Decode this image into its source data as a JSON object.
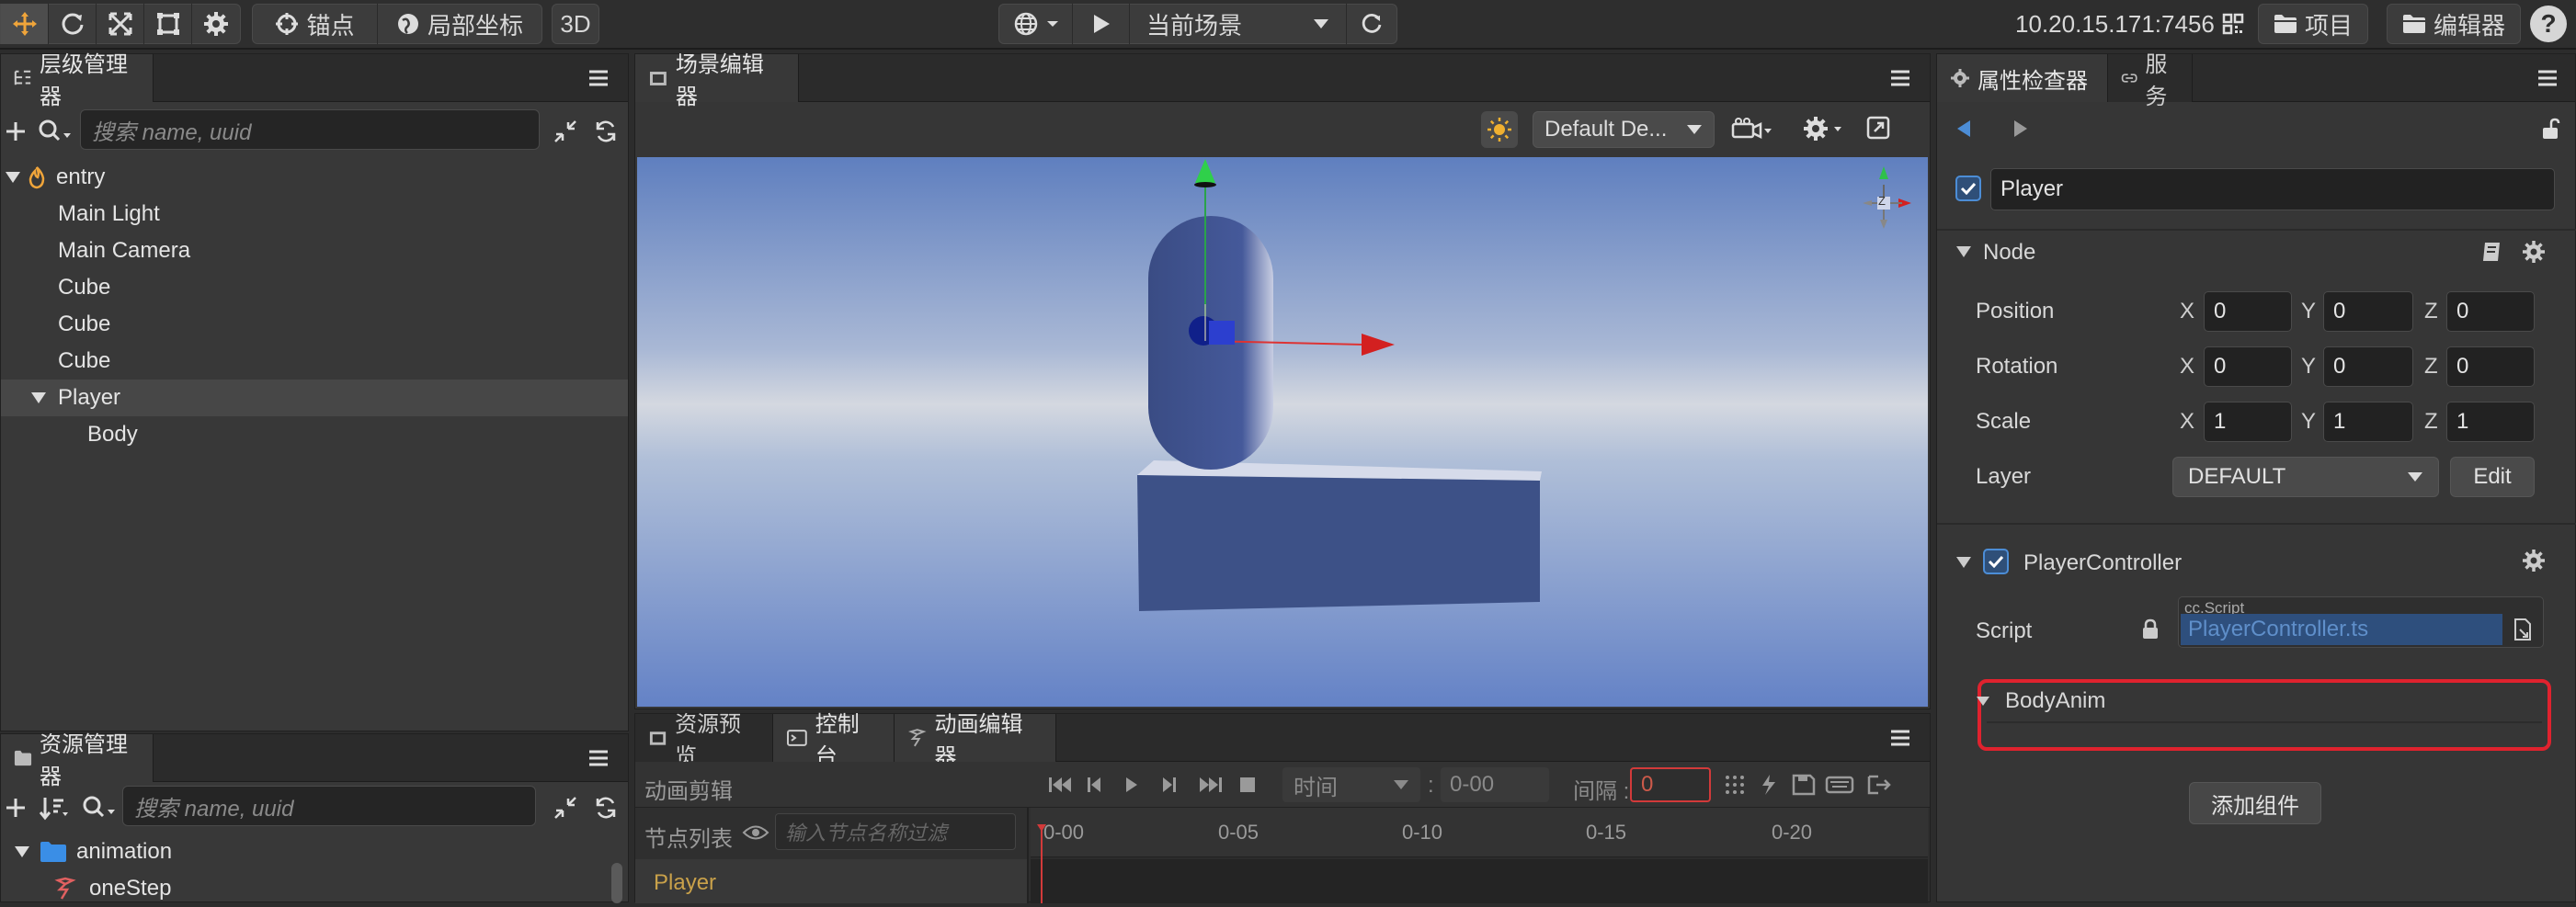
{
  "toolbar": {
    "anchor_label": "锚点",
    "local_coord_label": "局部坐标",
    "mode_3d_label": "3D",
    "scene_select": "当前场景",
    "address": "10.20.15.171:7456",
    "project_label": "项目",
    "editor_label": "编辑器"
  },
  "hierarchy": {
    "title": "层级管理器",
    "search_placeholder": "搜索 name, uuid",
    "items": [
      {
        "label": "entry"
      },
      {
        "label": "Main Light"
      },
      {
        "label": "Main Camera"
      },
      {
        "label": "Cube"
      },
      {
        "label": "Cube"
      },
      {
        "label": "Cube"
      },
      {
        "label": "Player"
      },
      {
        "label": "Body"
      }
    ]
  },
  "assets": {
    "title": "资源管理器",
    "search_placeholder": "搜索 name, uuid",
    "items": [
      {
        "label": "animation"
      },
      {
        "label": "oneStep"
      }
    ]
  },
  "scene": {
    "title": "场景编辑器",
    "camera_select": "Default De...",
    "gizmo_axis_label": "Z"
  },
  "bottom": {
    "tabs": [
      {
        "label": "资源预览"
      },
      {
        "label": "控制台"
      },
      {
        "label": "动画编辑器"
      }
    ],
    "clip_label": "动画剪辑",
    "time_select": "时间",
    "time_sep": ":",
    "time_value": "0-00",
    "interval_label": "间隔 :",
    "interval_value": "0",
    "node_list_label": "节点列表",
    "node_filter_placeholder": "输入节点名称过滤",
    "ruler": [
      "0-00",
      "0-05",
      "0-10",
      "0-15",
      "0-20"
    ],
    "node_row": "Player"
  },
  "inspector": {
    "tabs": [
      {
        "label": "属性检查器"
      },
      {
        "label": "服务"
      }
    ],
    "node_name": "Player",
    "node_section": "Node",
    "position": {
      "label": "Position",
      "x": "0",
      "y": "0",
      "z": "0"
    },
    "rotation": {
      "label": "Rotation",
      "x": "0",
      "y": "0",
      "z": "0"
    },
    "scale": {
      "label": "Scale",
      "x": "1",
      "y": "1",
      "z": "1"
    },
    "axis_x": "X",
    "axis_y": "Y",
    "axis_z": "Z",
    "layer": {
      "label": "Layer",
      "value": "DEFAULT",
      "edit": "Edit"
    },
    "component": "PlayerController",
    "script": {
      "label": "Script",
      "type_tag": "cc.Script",
      "value": "PlayerController.ts"
    },
    "body_anim": "BodyAnim",
    "add_component": "添加组件"
  },
  "colors": {
    "accent_blue": "#4c8dd6",
    "highlight_red": "#e0222e",
    "timeline_red": "#d23a3a",
    "node_orange": "#c9a14a"
  }
}
